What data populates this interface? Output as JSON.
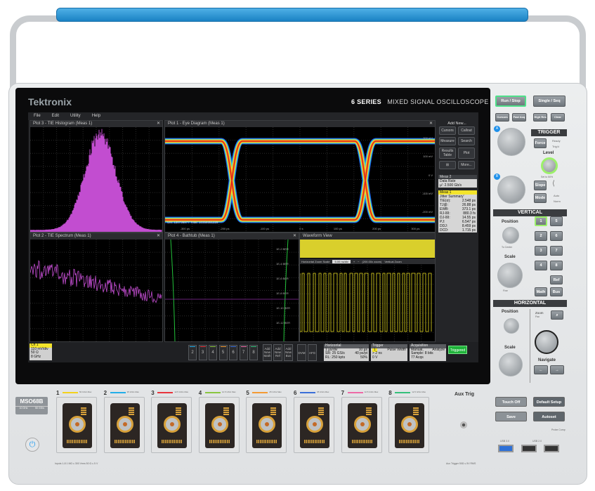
{
  "brand": {
    "logo": "Tektronix",
    "series": "6 SERIES",
    "subtitle": "MIXED SIGNAL OSCILLOSCOPE",
    "model": "MSO68B",
    "bandwidth": "10 GHz",
    "sample_rate": "50 GS/s"
  },
  "menu": [
    "File",
    "Edit",
    "Utility",
    "Help"
  ],
  "plots": {
    "plot3": {
      "title": "Plot 3 - TIE Histogram (Meas 1)"
    },
    "plot1": {
      "title": "Plot 1 - Eye Diagram (Meas 1)",
      "status": "UIs: 120736977  Total: 10359351229",
      "ticks": [
        "-300 ps",
        "-200 ps",
        "-100 ps",
        "0 s",
        "100 ps",
        "200 ps",
        "300 ps"
      ],
      "y_labels": [
        "200 mV",
        "100 mV",
        "0 V",
        "-100 mV",
        "-200 mV"
      ]
    },
    "plot2": {
      "title": "Plot 2 - TIE Spectrum (Meas 1)"
    },
    "plot4": {
      "title": "Plot 4 - Bathtub (Meas 1)",
      "y_labels": [
        "1E-2 BER",
        "1E-4 BER",
        "1E-6 BER",
        "1E-8 BER",
        "1E-10 BER",
        "1E-12 BER"
      ]
    },
    "waveform": {
      "title": "Waveform View",
      "zoom_label": "Horizontal Zoom Scale",
      "zoom_value": "5.00 ns/div",
      "zoom_factor": "(200.00x zoom)",
      "vertical_label": "Vertical Zoom"
    }
  },
  "right_panel": {
    "add_new": "Add New...",
    "buttons": [
      "Cursors",
      "Callout",
      "Measure",
      "Search",
      "Results Table",
      "Plot",
      "",
      "More..."
    ],
    "meas2": {
      "title": "Meas 2",
      "label": "Data Rate",
      "value": "µ': 2.500 Gb/s"
    },
    "meas1": {
      "title": "Meas 1",
      "label": "Jitter Summary'",
      "rows": [
        [
          "TIE(σ):",
          "2.548 ps"
        ],
        [
          "TJ@:",
          "26.88 ps"
        ],
        [
          "EWB:",
          "373.1 ps"
        ],
        [
          "RJ-δδ:",
          "880.3 fs"
        ],
        [
          "DJ-δδ:",
          "14.55 ps"
        ],
        [
          "PJ:",
          "6.547 ps"
        ],
        [
          "DDJ:",
          "8.459 ps"
        ],
        [
          "DCD:",
          "1.715 ps"
        ]
      ]
    }
  },
  "bottom_bar": {
    "ch1": {
      "title": "Ch 1",
      "scale": "110 mV/div",
      "impedance": "50 Ω",
      "bw": "8 GHz"
    },
    "channels": [
      "2",
      "3",
      "4",
      "5",
      "6",
      "7",
      "8"
    ],
    "add": [
      [
        "Add",
        "New",
        "Math"
      ],
      [
        "Add",
        "New",
        "Ref"
      ],
      [
        "Add",
        "New",
        "Bus"
      ]
    ],
    "dvm": "DVM",
    "afg": "AFG",
    "horizontal": {
      "title": "Horizontal",
      "rows": [
        [
          "1 µs/div",
          "10 µs"
        ],
        [
          "SR: 25 GS/s",
          "40 ps/pt"
        ],
        [
          "RL: 250 kpts",
          "50%"
        ]
      ]
    },
    "trigger": {
      "title": "Trigger",
      "source": "1",
      "type": "Pulse Width",
      "cond": "> 2 ns",
      "level": "0 V"
    },
    "acquisition": {
      "title": "Acquisition",
      "rows": [
        [
          "Manual,",
          "Analyze"
        ],
        [
          "Sample: 8 bits",
          ""
        ],
        [
          "77 Acqs",
          ""
        ]
      ]
    },
    "status": "Triggered"
  },
  "controls": {
    "run_stop": "Run / Stop",
    "single_seq": "Single / Seq",
    "cursors": "Cursors",
    "fast_acq": "Fast Acq",
    "high_res": "High Res",
    "clear": "Clear",
    "knob_a": "A",
    "knob_b": "B",
    "push": "Push",
    "push_sel": "Select",
    "trigger": {
      "title": "TRIGGER",
      "force": "Force",
      "ready": "Ready",
      "trigd": "Trig'd",
      "level": "Level",
      "set50": "Set to 50%",
      "slope": "Slope",
      "mode": "Mode",
      "auto": "Auto",
      "norm": "Norm"
    },
    "vertical": {
      "title": "VERTICAL",
      "position": "Position",
      "to_center": "To Center",
      "scale": "Scale",
      "fine": "Fine",
      "channels": [
        "1",
        "5",
        "2",
        "6",
        "3",
        "7",
        "4",
        "8"
      ],
      "ref": "Ref",
      "math": "Math",
      "bus": "Bus"
    },
    "horizontal": {
      "title": "HORIZONTAL",
      "position": "Position",
      "scale": "Scale",
      "zoom": "Zoom",
      "pan": "Pan",
      "navigate": "Navigate"
    }
  },
  "front": {
    "inputs": [
      {
        "n": "1",
        "color": "#f3d21c",
        "spec": "50 GS/s Max"
      },
      {
        "n": "2",
        "color": "#22aee8",
        "spec": "25 GS/s Max"
      },
      {
        "n": "3",
        "color": "#e8343c",
        "spec": "12.5 GS/s Max"
      },
      {
        "n": "4",
        "color": "#8ac63f",
        "spec": "12.5 GS/s Max"
      },
      {
        "n": "5",
        "color": "#f39a34",
        "spec": "25 GS/s Max"
      },
      {
        "n": "6",
        "color": "#3a6fd8",
        "spec": "25 GS/s Max"
      },
      {
        "n": "7",
        "color": "#ee6aa6",
        "spec": "12.5 GS/s Max"
      },
      {
        "n": "8",
        "color": "#34c07a",
        "spec": "12.5 GS/s Max"
      }
    ],
    "inputs_note": "Inputs 1-8   1 MΩ ≤ 300 Vrms   50 Ω ≤ 5 V",
    "aux_trig": "Aux Trig",
    "aux_note": "Aux Trigger  50Ω ≤ 5V RMS",
    "touch_off": "Touch Off",
    "default_setup": "Default Setup",
    "save": "Save",
    "autoset": "Autoset",
    "probe_comp": "Probe Comp",
    "usb3": "USB 3.0",
    "usb2": "USB 2.0"
  }
}
